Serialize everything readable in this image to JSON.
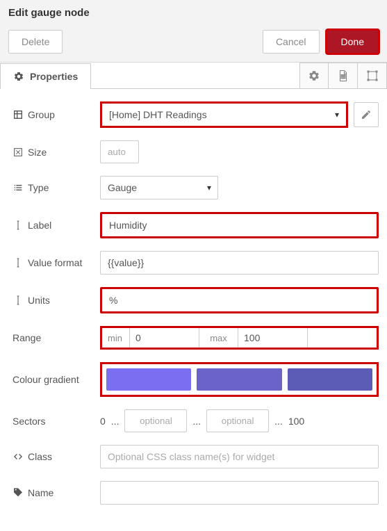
{
  "header": {
    "title": "Edit gauge node",
    "delete": "Delete",
    "cancel": "Cancel",
    "done": "Done"
  },
  "tabs": {
    "properties": "Properties"
  },
  "labels": {
    "group": "Group",
    "size": "Size",
    "type": "Type",
    "label": "Label",
    "value_format": "Value format",
    "units": "Units",
    "range": "Range",
    "colour_gradient": "Colour gradient",
    "sectors": "Sectors",
    "class": "Class",
    "name": "Name"
  },
  "fields": {
    "group": "[Home] DHT Readings",
    "size": "auto",
    "type": "Gauge",
    "label": "Humidity",
    "value_format": "{{value}}",
    "units": "%",
    "range_min_label": "min",
    "range_min": "0",
    "range_max_label": "max",
    "range_max": "100",
    "gradient": {
      "c1": "#7a6ff0",
      "c2": "#6a63c8",
      "c3": "#5c5bb5"
    },
    "sectors_start": "0",
    "sectors_dots": "...",
    "sectors_optional": "optional",
    "sectors_end": "100",
    "class_placeholder": "Optional CSS class name(s) for widget",
    "name": ""
  }
}
